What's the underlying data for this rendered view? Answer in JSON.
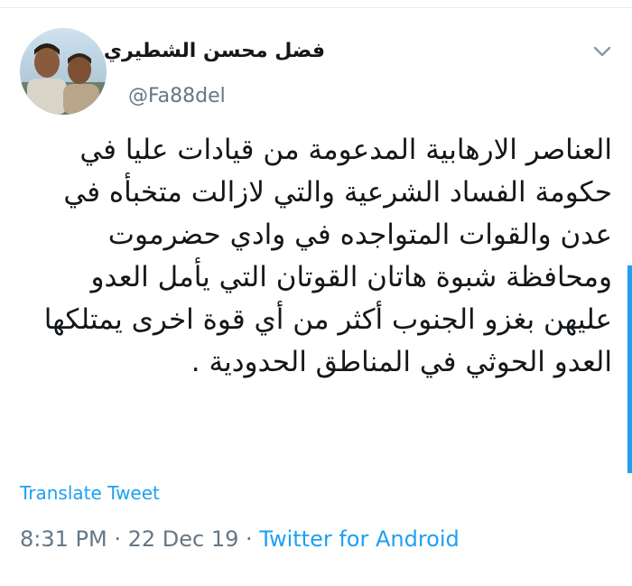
{
  "user": {
    "display_name": "فضل محسن الشطيري",
    "handle": "@Fa88del"
  },
  "tweet": {
    "text": "العناصر الارهابية المدعومة من قيادات عليا في حكومة الفساد الشرعية والتي لازالت متخبأه في عدن والقوات المتواجده في وادي حضرموت ومحافظة شبوة هاتان القوتان التي يأمل العدو عليهن بغزو الجنوب أكثر من أي قوة اخرى يمتلكها العدو الحوثي في المناطق الحدودية .",
    "translate_label": "Translate Tweet",
    "time": "8:31 PM",
    "separator1": " · ",
    "date": "22 Dec 19",
    "separator2": " · ",
    "source": "Twitter for Android"
  },
  "icons": {
    "avatar": "avatar-photo",
    "menu": "chevron-down-icon"
  },
  "colors": {
    "accent": "#1da1f2",
    "secondary_text": "#657786",
    "primary_text": "#14171a"
  }
}
